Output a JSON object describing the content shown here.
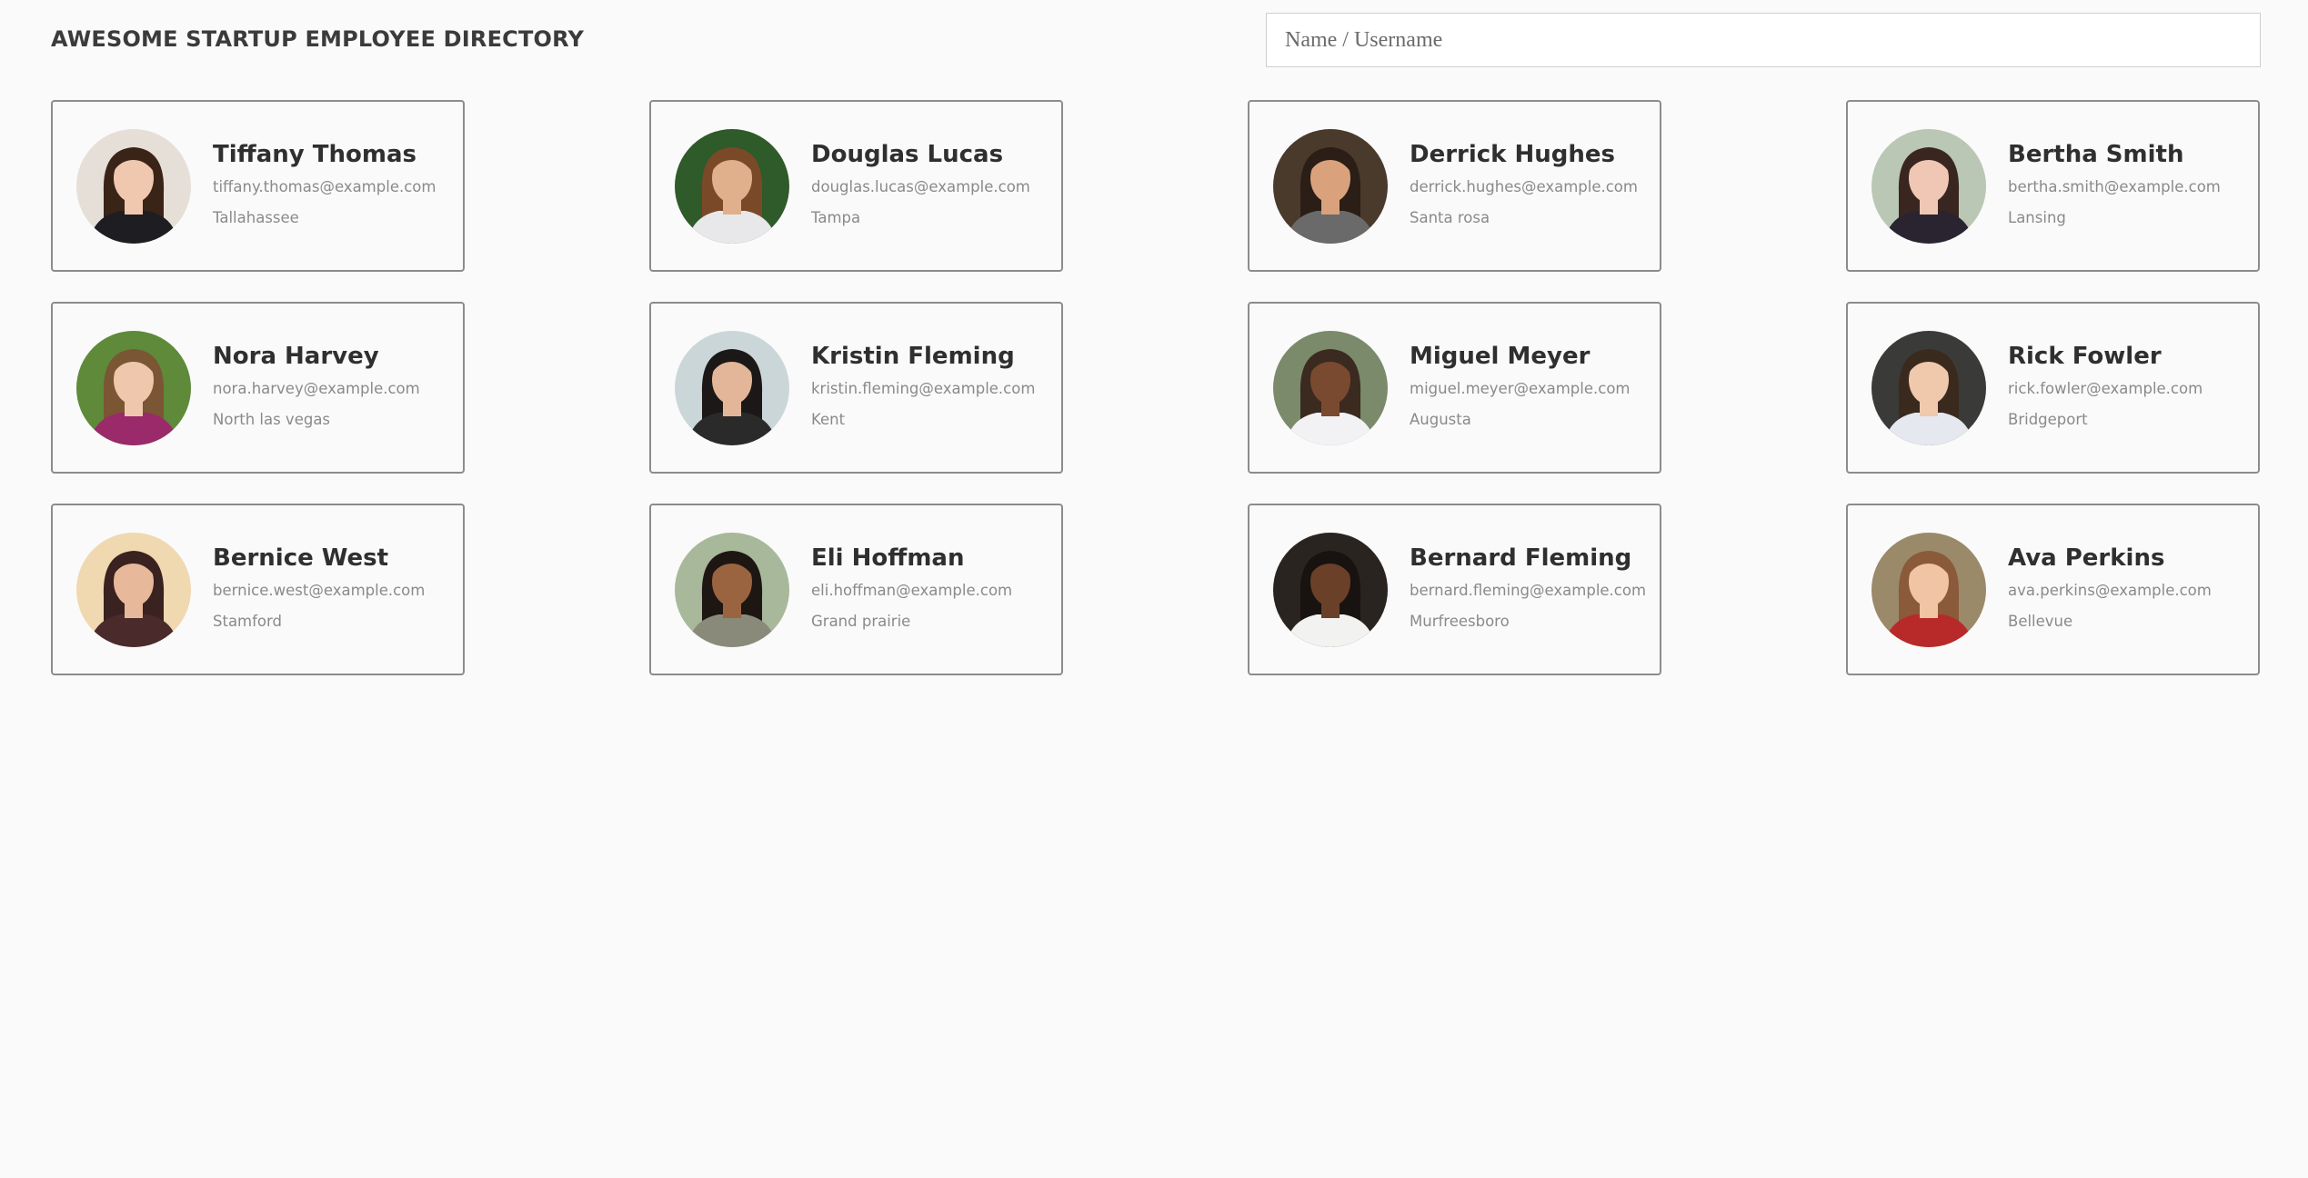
{
  "header": {
    "title": "AWESOME STARTUP EMPLOYEE DIRECTORY",
    "search_placeholder": "Name / Username",
    "search_value": ""
  },
  "employees": [
    {
      "name": "Tiffany Thomas",
      "email": "tiffany.thomas@example.com",
      "city": "Tallahassee",
      "photo": {
        "bg": "#e6dfd8",
        "skin": "#f0c8b0",
        "hair": "#3a2418",
        "shirt": "#1e1e22"
      }
    },
    {
      "name": "Douglas Lucas",
      "email": "douglas.lucas@example.com",
      "city": "Tampa",
      "photo": {
        "bg": "#2f5a2a",
        "skin": "#e0b08c",
        "hair": "#7a4a28",
        "shirt": "#e8e8ea"
      }
    },
    {
      "name": "Derrick Hughes",
      "email": "derrick.hughes@example.com",
      "city": "Santa rosa",
      "photo": {
        "bg": "#4a3a2c",
        "skin": "#d9a27c",
        "hair": "#2a1e16",
        "shirt": "#6a6a6a"
      }
    },
    {
      "name": "Bertha Smith",
      "email": "bertha.smith@example.com",
      "city": "Lansing",
      "photo": {
        "bg": "#b9c7b4",
        "skin": "#f0c6b4",
        "hair": "#3a2620",
        "shirt": "#2a2430"
      }
    },
    {
      "name": "Nora Harvey",
      "email": "nora.harvey@example.com",
      "city": "North las vegas",
      "photo": {
        "bg": "#5e8a3a",
        "skin": "#efc7ac",
        "hair": "#7a5634",
        "shirt": "#9a2a6a"
      }
    },
    {
      "name": "Kristin Fleming",
      "email": "kristin.fleming@example.com",
      "city": "Kent",
      "photo": {
        "bg": "#cbd6d8",
        "skin": "#e3b69a",
        "hair": "#1c1818",
        "shirt": "#2a2a2a"
      }
    },
    {
      "name": "Miguel Meyer",
      "email": "miguel.meyer@example.com",
      "city": "Augusta",
      "photo": {
        "bg": "#7a8a6a",
        "skin": "#7a4a30",
        "hair": "#3a2a20",
        "shirt": "#f2f2f4"
      }
    },
    {
      "name": "Rick Fowler",
      "email": "rick.fowler@example.com",
      "city": "Bridgeport",
      "photo": {
        "bg": "#3a3a38",
        "skin": "#f0c8ac",
        "hair": "#3a2a1e",
        "shirt": "#e6e8f0"
      }
    },
    {
      "name": "Bernice West",
      "email": "bernice.west@example.com",
      "city": "Stamford",
      "photo": {
        "bg": "#f0d8b0",
        "skin": "#e8b89a",
        "hair": "#3a2220",
        "shirt": "#4a2a2a"
      }
    },
    {
      "name": "Eli Hoffman",
      "email": "eli.hoffman@example.com",
      "city": "Grand prairie",
      "photo": {
        "bg": "#a8b89a",
        "skin": "#9a6440",
        "hair": "#1e1612",
        "shirt": "#8a8a7a"
      }
    },
    {
      "name": "Bernard Fleming",
      "email": "bernard.fleming@example.com",
      "city": "Murfreesboro",
      "photo": {
        "bg": "#2a2420",
        "skin": "#6a4028",
        "hair": "#181210",
        "shirt": "#f2f2f0"
      }
    },
    {
      "name": "Ava Perkins",
      "email": "ava.perkins@example.com",
      "city": "Bellevue",
      "photo": {
        "bg": "#9a8a6a",
        "skin": "#f0c4a4",
        "hair": "#8a5a3a",
        "shirt": "#b82a2a"
      }
    }
  ]
}
